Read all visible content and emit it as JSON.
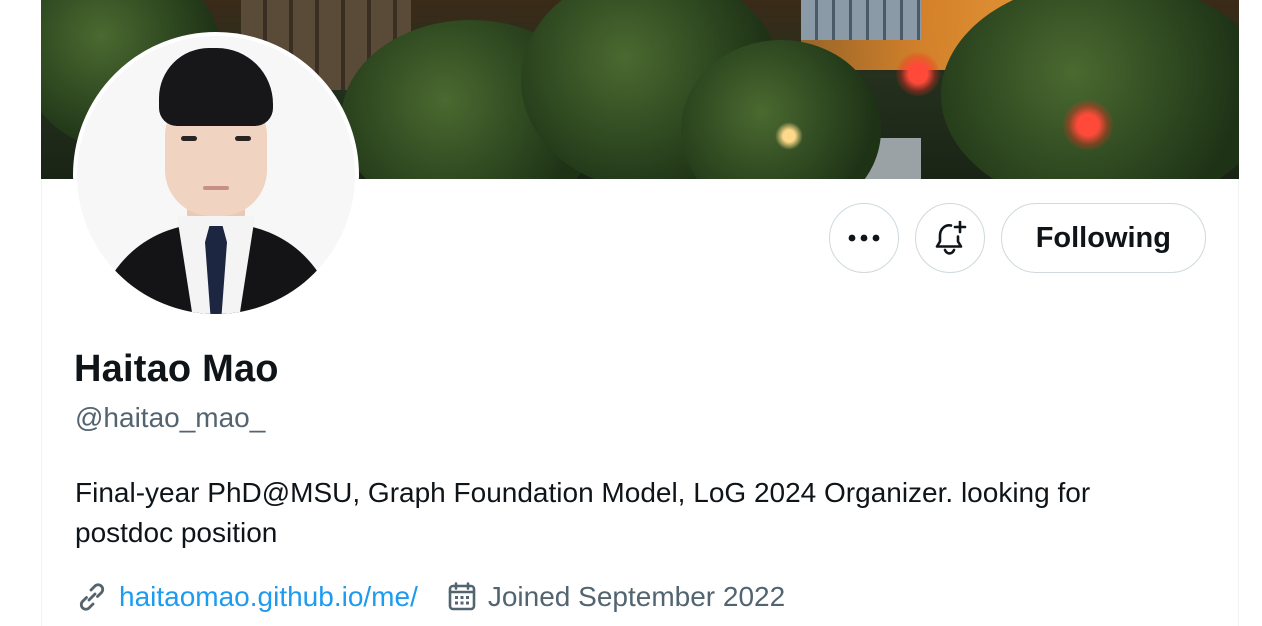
{
  "profile": {
    "name": "Haitao Mao",
    "handle": "@haitao_mao_",
    "bio": "Final-year PhD@MSU, Graph Foundation Model, LoG 2024 Organizer. looking for postdoc position",
    "website": "haitaomao.github.io/me/",
    "joined": "Joined September 2022"
  },
  "actions": {
    "more_icon": "more-horizontal-icon",
    "notify_icon": "bell-plus-icon",
    "follow_label": "Following"
  },
  "meta_icons": {
    "link_icon": "link-icon",
    "calendar_icon": "calendar-icon"
  },
  "colors": {
    "text_primary": "#0f1419",
    "text_secondary": "#536471",
    "link": "#1d9bf0",
    "button_border": "#cfd9de"
  }
}
